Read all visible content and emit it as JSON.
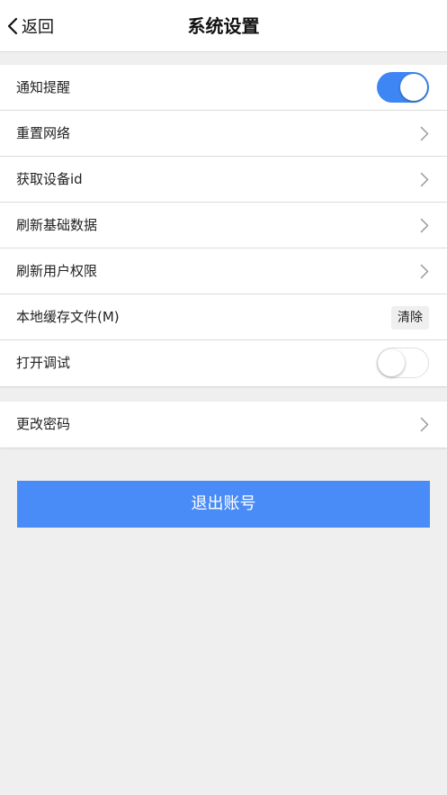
{
  "header": {
    "back_label": "返回",
    "title": "系统设置"
  },
  "settings": {
    "notify": {
      "label": "通知提醒",
      "enabled": true
    },
    "reset_network": {
      "label": "重置网络"
    },
    "device_id": {
      "label": "获取设备id"
    },
    "refresh_base": {
      "label": "刷新基础数据"
    },
    "refresh_perm": {
      "label": "刷新用户权限"
    },
    "cache": {
      "label": "本地缓存文件(M)",
      "action": "清除"
    },
    "debug": {
      "label": "打开调试",
      "enabled": false
    }
  },
  "account": {
    "change_password": {
      "label": "更改密码"
    }
  },
  "logout_label": "退出账号",
  "colors": {
    "accent": "#3f86f5",
    "logout_button": "#4a8cf7",
    "background": "#efefef"
  },
  "icons": {
    "back": "chevron-left-icon",
    "row_arrow": "chevron-right-icon"
  }
}
